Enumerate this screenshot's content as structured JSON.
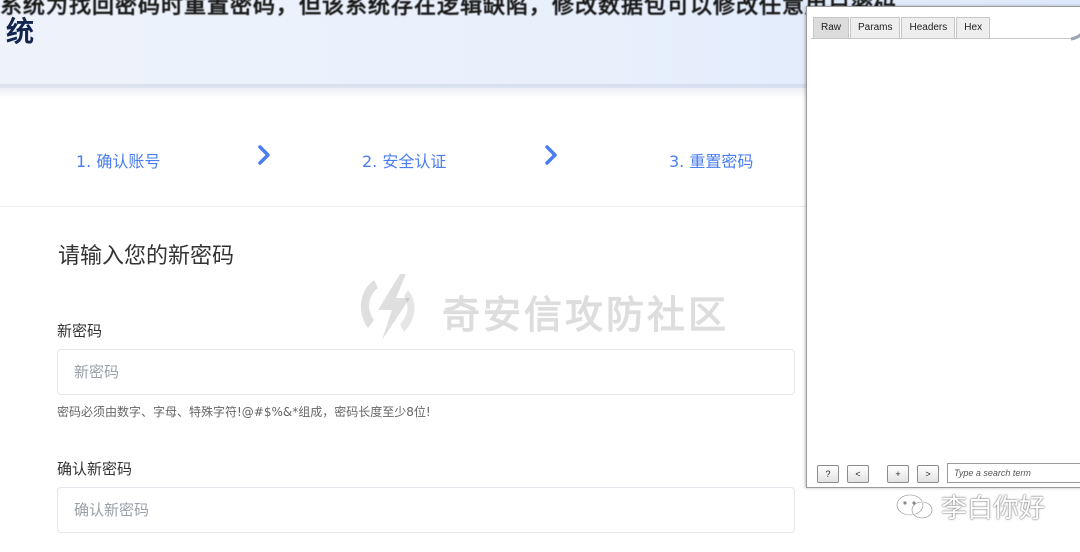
{
  "banner": {
    "overflow_text": "系统为找回密码时重置密码，但该系统存在逻辑缺陷，修改数据包可以修改任意用户密码",
    "title": "统"
  },
  "steps": [
    {
      "label": "1. 确认账号"
    },
    {
      "label": "2. 安全认证"
    },
    {
      "label": "3. 重置密码"
    }
  ],
  "form": {
    "heading": "请输入您的新密码",
    "new_password": {
      "label": "新密码",
      "placeholder": "新密码",
      "value": ""
    },
    "hint": "密码必须由数字、字母、特殊字符!@#$%&*组成，密码长度至少8位!",
    "confirm_password": {
      "label": "确认新密码",
      "placeholder": "确认新密码",
      "value": ""
    }
  },
  "watermark": {
    "text": "奇安信攻防社区"
  },
  "wechat": {
    "text": "李白你好",
    "icon": "wechat-icon"
  },
  "burp": {
    "tabs": [
      "Raw",
      "Params",
      "Headers",
      "Hex"
    ],
    "active_tab": "Raw",
    "buttons": {
      "help": "?",
      "prev": "<",
      "add": "+",
      "next": ">"
    },
    "search_placeholder": "Type a search term"
  },
  "colors": {
    "step_accent": "#4a7df0",
    "banner_title": "#13244d"
  }
}
